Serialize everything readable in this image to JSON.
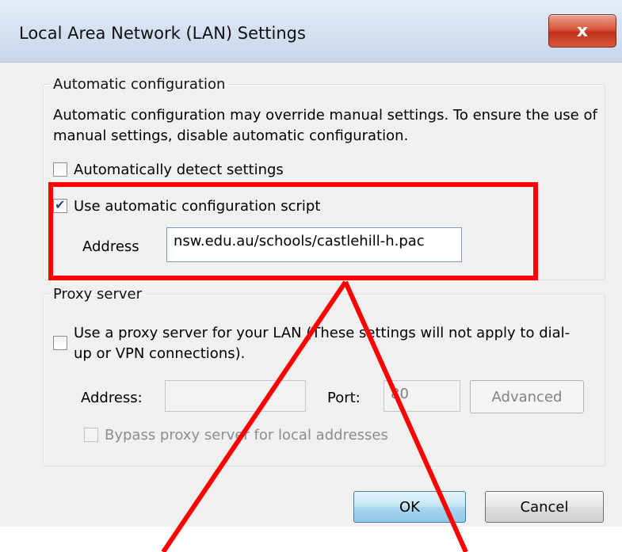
{
  "dialog": {
    "title": "Local Area Network (LAN) Settings",
    "close_label": "x"
  },
  "auto_config": {
    "legend": "Automatic configuration",
    "description": "Automatic configuration may override manual settings.  To ensure the use of manual settings, disable automatic configuration.",
    "detect_label": "Automatically detect settings",
    "detect_checked": false,
    "script_label": "Use automatic configuration script",
    "script_checked": true,
    "address_label": "Address",
    "address_value": "nsw.edu.au/schools/castlehill-h.pac"
  },
  "proxy": {
    "legend": "Proxy server",
    "use_proxy_label": "Use a proxy server for your LAN (These settings will not apply to dial-up or VPN connections).",
    "use_proxy_checked": false,
    "address_label": "Address:",
    "address_value": "",
    "port_label": "Port:",
    "port_value": "80",
    "advanced_label": "Advanced",
    "bypass_label": "Bypass proxy server for local addresses",
    "bypass_checked": false
  },
  "buttons": {
    "ok_label": "OK",
    "cancel_label": "Cancel"
  },
  "colors": {
    "highlight": "#ff0000",
    "title_bar": "#d6e2f0",
    "close_button": "#c0311c"
  }
}
